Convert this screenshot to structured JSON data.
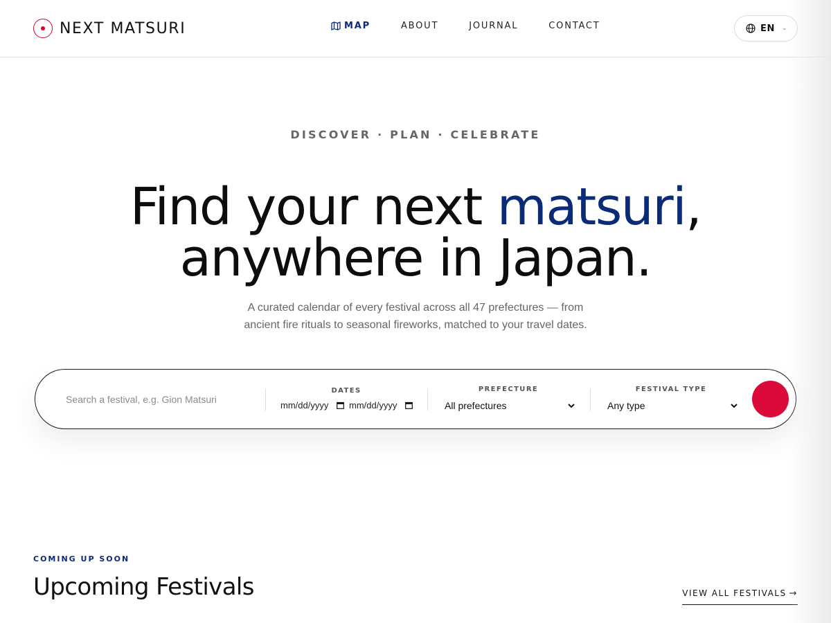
{
  "brand": {
    "name": "NEXT MATSURI",
    "accent": "#d8002f"
  },
  "nav": {
    "items": [
      {
        "label": "MAP",
        "icon": "map-icon",
        "active": true
      },
      {
        "label": "ABOUT"
      },
      {
        "label": "JOURNAL"
      },
      {
        "label": "CONTACT"
      }
    ]
  },
  "language": {
    "label": "EN",
    "icon": "globe-icon"
  },
  "hero": {
    "eyebrow": "DISCOVER · PLAN · CELEBRATE",
    "title_before": "Find your next ",
    "title_accent": "matsuri",
    "title_after": ",",
    "title_line2": "anywhere in Japan.",
    "subtitle_line1": "A curated calendar of every festival across all 47 prefectures — from",
    "subtitle_line2": "ancient fire rituals to seasonal fireworks, matched to your travel dates.",
    "accent_color": "#0b2a78"
  },
  "search": {
    "placeholder": "Search a festival, e.g. Gion Matsuri",
    "dates_label": "DATES",
    "date_from_placeholder": "mm/dd/yyyy",
    "date_to_placeholder": "mm/dd/yyyy",
    "prefecture_label": "PREFECTURE",
    "prefecture_value": "All prefectures",
    "type_label": "FESTIVAL TYPE",
    "type_value": "Any type",
    "button_color": "#dc0a3a"
  },
  "upcoming": {
    "eyebrow": "COMING UP SOON",
    "title": "Upcoming Festivals",
    "view_all": "VIEW ALL FESTIVALS",
    "arrow": "→"
  }
}
